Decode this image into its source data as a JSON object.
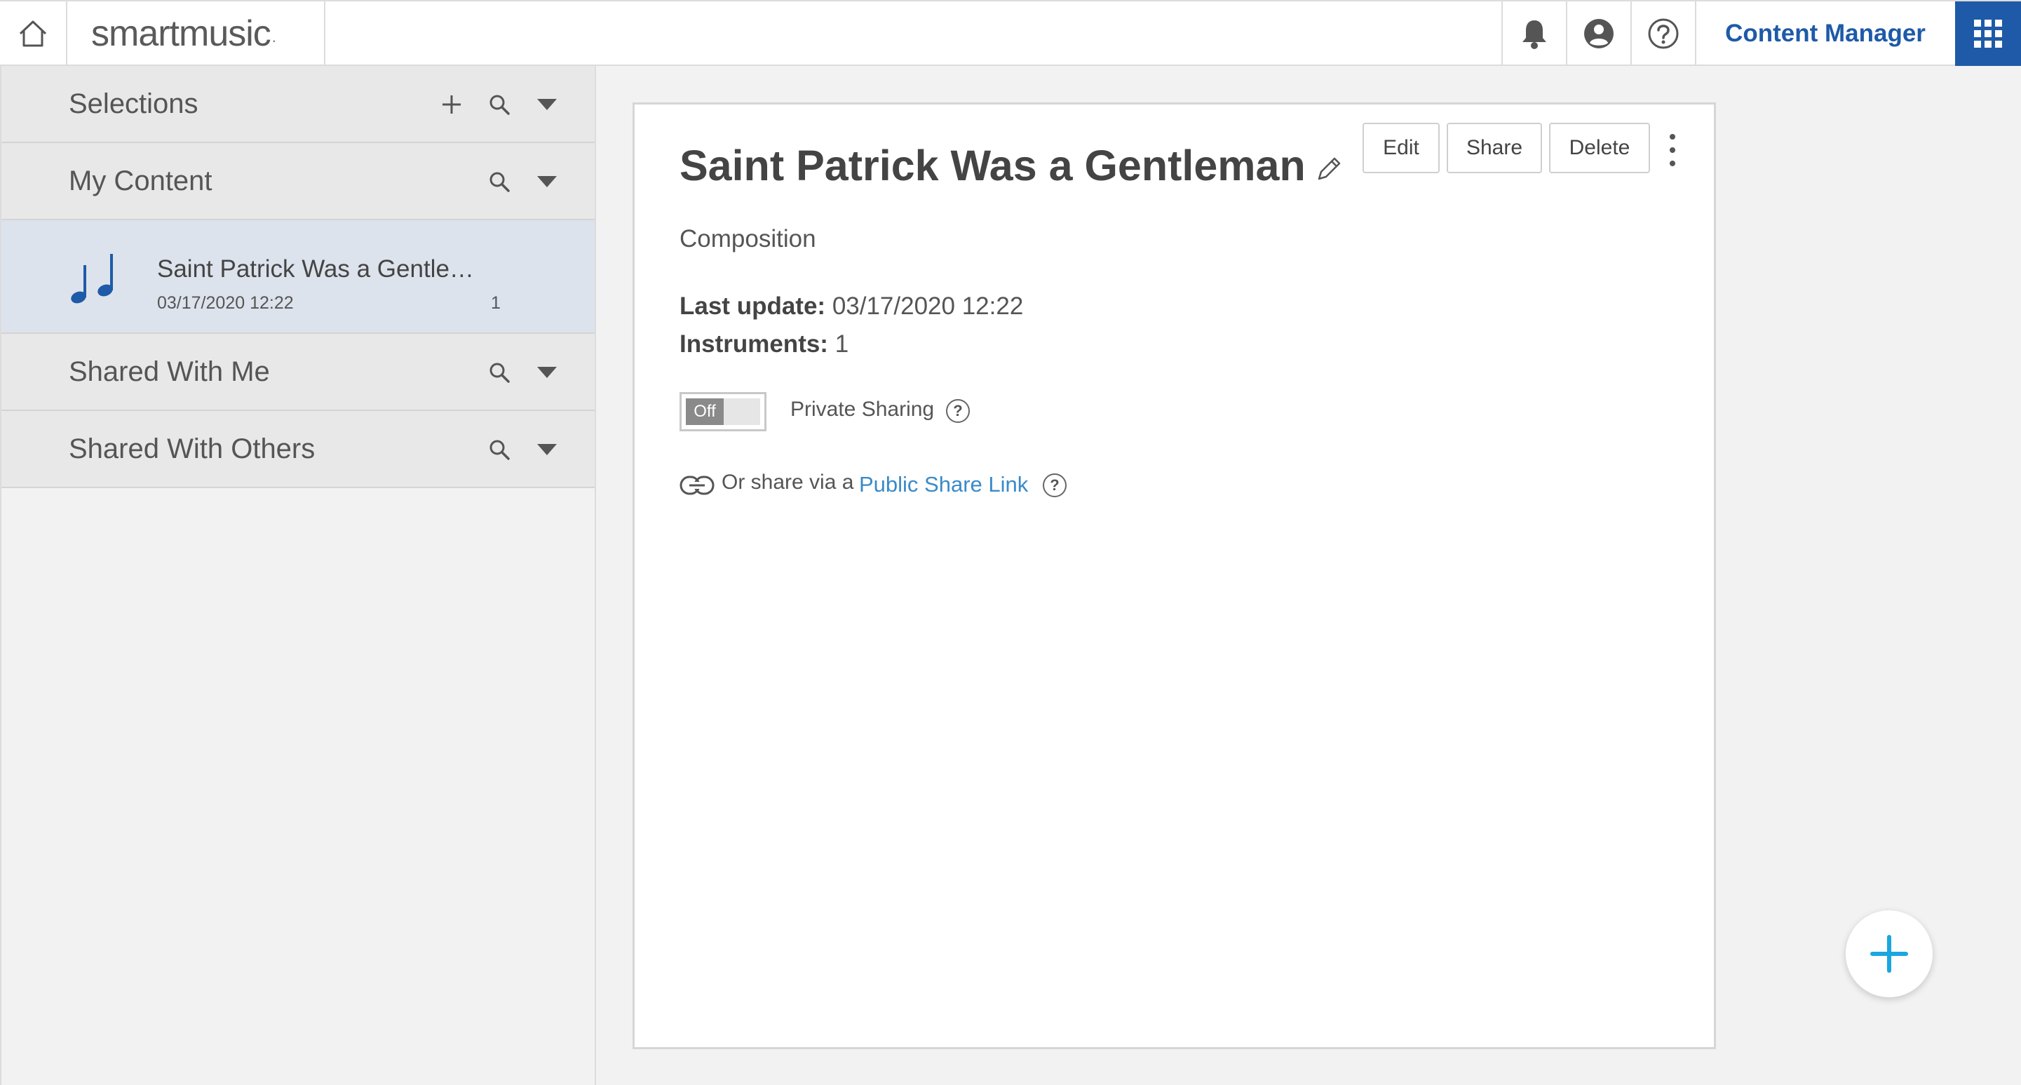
{
  "header": {
    "logo": "smartmusic",
    "logo_mark": ".",
    "content_manager_label": "Content Manager",
    "icons": [
      "home-icon",
      "bell-icon",
      "user-icon",
      "help-icon",
      "apps-grid-icon"
    ]
  },
  "sidebar": {
    "sections": [
      {
        "label": "Selections"
      },
      {
        "label": "My Content"
      },
      {
        "label": "Shared With Me"
      },
      {
        "label": "Shared With Others"
      }
    ],
    "my_content_items": [
      {
        "title": "Saint Patrick Was a Gentle…",
        "date": "03/17/2020 12:22",
        "count": "1"
      }
    ]
  },
  "detail": {
    "title": "Saint Patrick Was a Gentleman",
    "type": "Composition",
    "last_update_label": "Last update:",
    "last_update_value": "03/17/2020 12:22",
    "instruments_label": "Instruments:",
    "instruments_value": "1",
    "buttons": {
      "edit": "Edit",
      "share": "Share",
      "delete": "Delete"
    },
    "toggle_state": "Off",
    "private_sharing_label": "Private Sharing",
    "help_glyph": "?",
    "or_share_text": "Or share via a",
    "public_link_text": "Public Share Link"
  },
  "colors": {
    "brand": "#1e5aa8",
    "link": "#3a8ac8",
    "fab_plus": "#1aa7e0",
    "selected_item_bg": "#dde3ec"
  }
}
